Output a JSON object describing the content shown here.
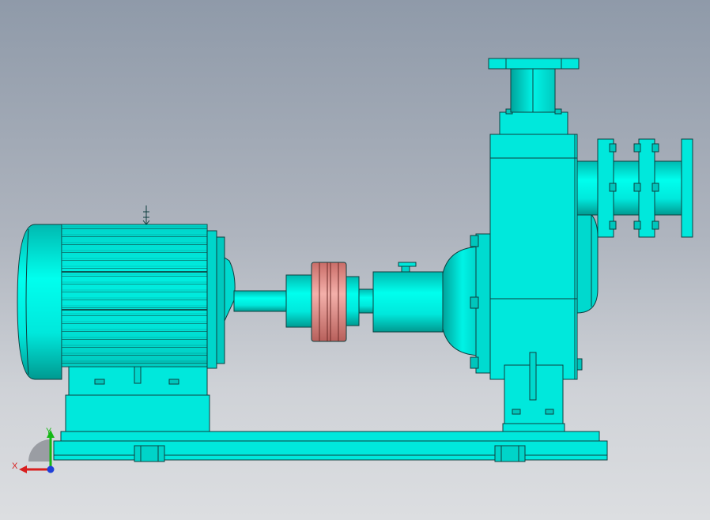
{
  "viewport": {
    "background_top": "#8f9aa9",
    "background_bottom": "#dcdee1"
  },
  "model": {
    "body_color": "#00e8dc",
    "body_shade": "#00b5ad",
    "outline_color": "#0f3f3f",
    "coupling_color": "#e59a94"
  },
  "triad": {
    "x_label": "X",
    "y_label": "Y",
    "x_color": "#d81f1f",
    "y_color": "#14b814",
    "z_color": "#1f3fd8"
  }
}
